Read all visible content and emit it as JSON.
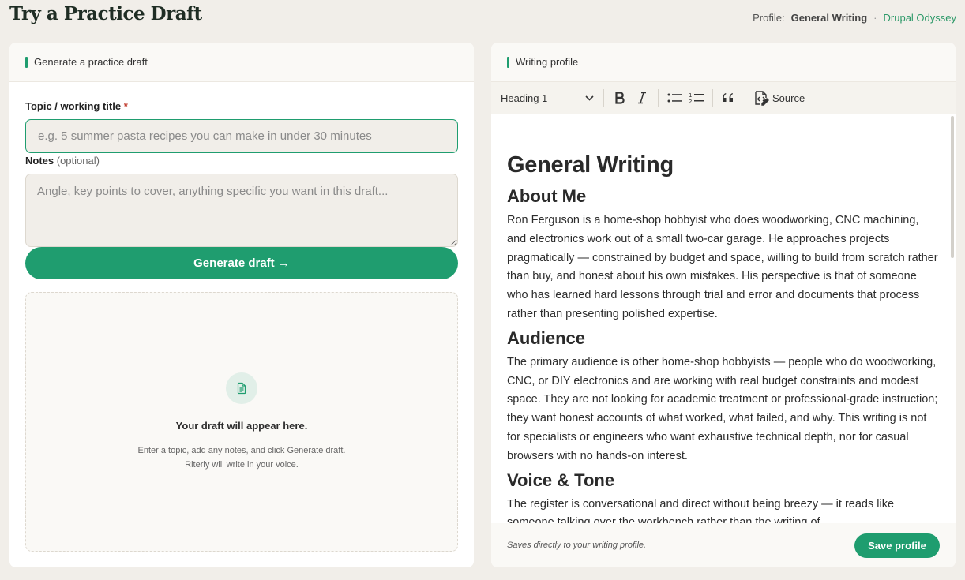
{
  "page": {
    "title": "Try a Practice Draft",
    "profile_label": "Profile:",
    "profile_name": "General Writing",
    "separator": "·",
    "site_name": "Drupal Odyssey"
  },
  "left": {
    "header": "Generate a practice draft",
    "topic_label": "Topic / working title",
    "required_mark": "*",
    "topic_placeholder": "e.g. 5 summer pasta recipes you can make in under 30 minutes",
    "topic_value": "",
    "notes_label": "Notes",
    "notes_optional": "(optional)",
    "notes_placeholder": "Angle, key points to cover, anything specific you want in this draft...",
    "generate_button": "Generate draft →",
    "empty_title": "Your draft will appear here.",
    "empty_line1": "Enter a topic, add any notes, and click Generate draft.",
    "empty_line2": "Riterly will write in your voice."
  },
  "right": {
    "header": "Writing profile",
    "toolbar": {
      "heading_select": "Heading 1",
      "source_label": "Source",
      "icons": [
        "bold-icon",
        "italic-icon",
        "bulleted-list-icon",
        "numbered-list-icon",
        "blockquote-icon",
        "source-icon"
      ]
    },
    "editor": {
      "title": "General Writing",
      "sections": [
        {
          "heading": "About Me",
          "body": "Ron Ferguson is a home-shop hobbyist who does woodworking, CNC machining, and electronics work out of a small two-car garage. He approaches projects pragmatically — constrained by budget and space, willing to build from scratch rather than buy, and honest about his own mistakes. His perspective is that of someone who has learned hard lessons through trial and error and documents that process rather than presenting polished expertise."
        },
        {
          "heading": "Audience",
          "body": "The primary audience is other home-shop hobbyists — people who do woodworking, CNC, or DIY electronics and are working with real budget constraints and modest space. They are not looking for academic treatment or professional-grade instruction; they want honest accounts of what worked, what failed, and why. This writing is not for specialists or engineers who want exhaustive technical depth, nor for casual browsers with no hands-on interest."
        },
        {
          "heading": "Voice & Tone",
          "body": "The register is conversational and direct without being breezy — it reads like someone talking over the workbench rather than the writing of"
        }
      ]
    },
    "footer_note": "Saves directly to your writing profile.",
    "save_button": "Save profile"
  },
  "colors": {
    "accent": "#1f9d6f",
    "background": "#f1eee9",
    "link": "#2f9a6a",
    "required": "#c0392b"
  }
}
